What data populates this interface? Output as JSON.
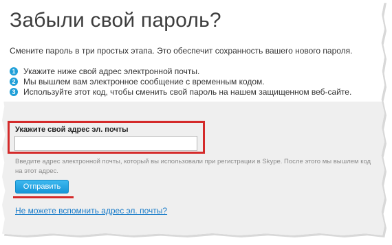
{
  "page": {
    "title": "Забыли свой пароль?",
    "subtitle": "Смените пароль в три простых этапа. Это обеспечит сохранность вашего нового пароля."
  },
  "steps": [
    {
      "number": "1",
      "text": "Укажите ниже свой адрес электронной почты."
    },
    {
      "number": "2",
      "text": "Мы вышлем вам электронное сообщение с временным кодом."
    },
    {
      "number": "3",
      "text": "Используйте этот код, чтобы сменить свой пароль на нашем защищенном веб-сайте."
    }
  ],
  "form": {
    "email_label": "Укажите свой адрес эл. почты",
    "email_value": "",
    "help_text": "Введите адрес электронной почты, который вы использовали при регистрации в Skype. После этого мы вышлем код на этот адрес.",
    "submit_label": "Отправить",
    "forgot_email_link": "Не можете вспомнить адрес эл. почты?"
  },
  "colors": {
    "accent": "#1f9fd8",
    "highlight": "#d42a2a",
    "link": "#1a7cc9"
  }
}
